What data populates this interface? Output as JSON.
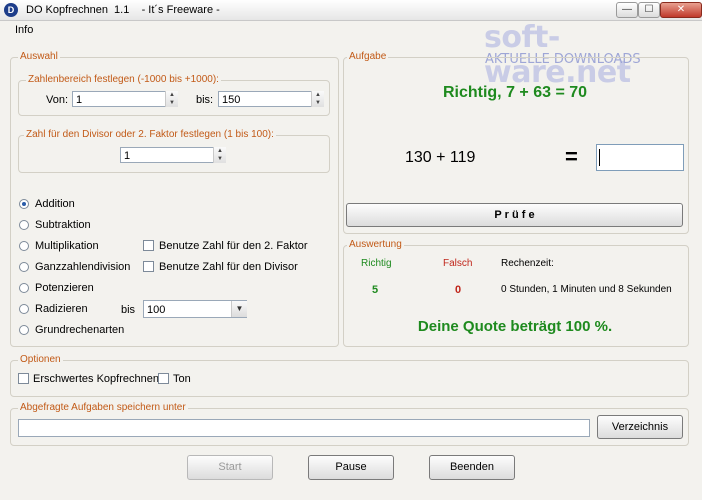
{
  "window": {
    "title": "DO Kopfrechnen  1.1    - It´s Freeware -",
    "app_icon": "D",
    "controls": {
      "minimize": "—",
      "maximize": "☐",
      "close": "✕"
    }
  },
  "watermark": {
    "brand": "soft-ware.net",
    "sub": "AKTUELLE DOWNLOADS"
  },
  "menu": {
    "items": [
      "Info"
    ]
  },
  "auswahl": {
    "legend": "Auswahl",
    "range_group": {
      "legend": "Zahlenbereich festlegen (-1000 bis +1000):",
      "von_label": "Von:",
      "von_value": "1",
      "bis_label": "bis:",
      "bis_value": "150"
    },
    "divisor_group": {
      "legend": "Zahl für den Divisor oder 2. Faktor festlegen (1 bis 100):",
      "value": "1"
    },
    "operations": [
      "Addition",
      "Subtraktion",
      "Multiplikation",
      "Ganzzahlendivision",
      "Potenzieren",
      "Radizieren",
      "Grundrechenarten"
    ],
    "selected_operation": "Addition",
    "checks": {
      "factor2": "Benutze Zahl für den 2. Faktor",
      "divisor": "Benutze Zahl für den Divisor"
    },
    "radizieren_bis_label": "bis",
    "radizieren_value": "100"
  },
  "aufgabe": {
    "legend": "Aufgabe",
    "result_message": "Richtig, 7 + 63 = 70",
    "task": "130 + 119",
    "equals": "=",
    "answer_value": "",
    "check_button": "P r ü f e",
    "success_color": "#1e8a1e",
    "error_color": "#c0261b"
  },
  "auswertung": {
    "legend": "Auswertung",
    "richtig_label": "Richtig",
    "richtig_value": "5",
    "falsch_label": "Falsch",
    "falsch_value": "0",
    "rechenzeit_label": "Rechenzeit:",
    "rechenzeit_value": "0 Stunden, 1 Minuten und 8 Sekunden",
    "quote": "Deine Quote beträgt 100 %."
  },
  "optionen": {
    "legend": "Optionen",
    "erschwert": "Erschwertes Kopfrechnen",
    "ton": "Ton"
  },
  "speichern": {
    "legend": "Abgefragte Aufgaben speichern unter",
    "path_value": "",
    "verzeichnis_button": "Verzeichnis"
  },
  "footer": {
    "start": "Start",
    "pause": "Pause",
    "beenden": "Beenden"
  }
}
